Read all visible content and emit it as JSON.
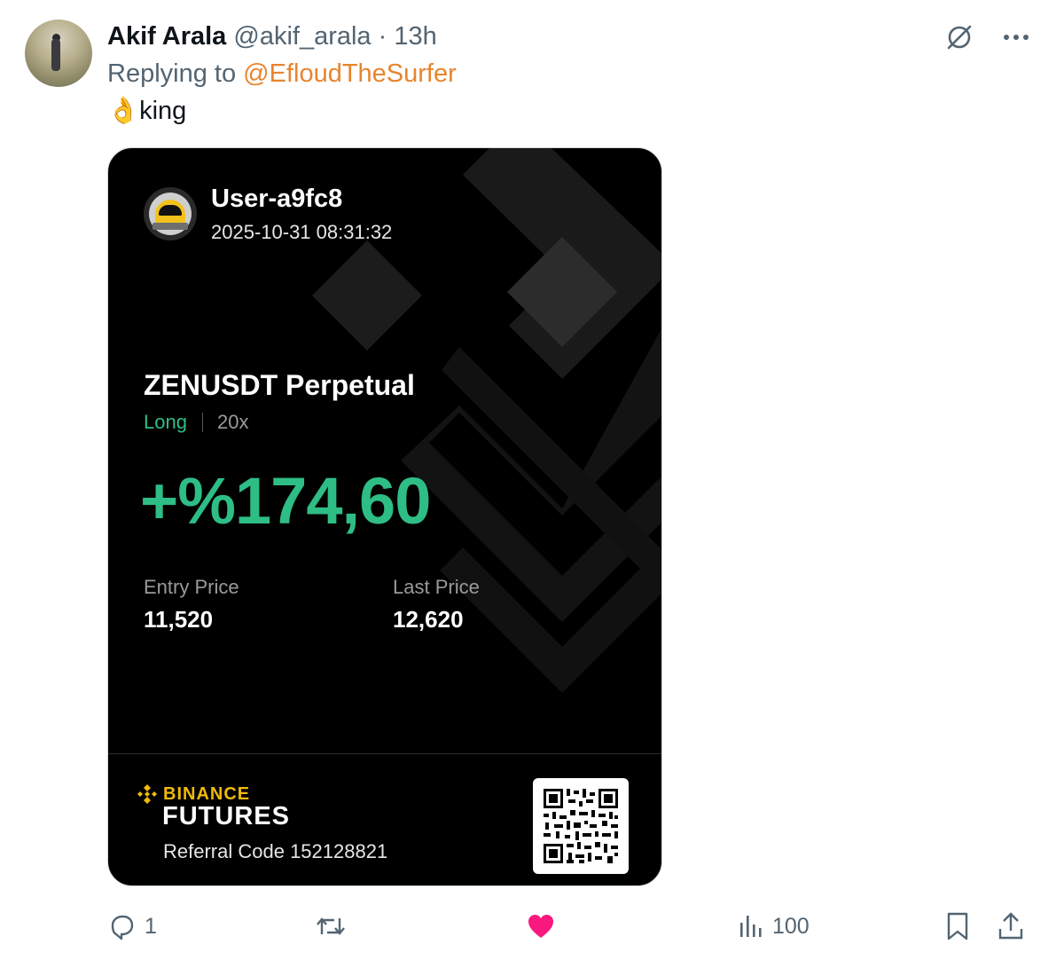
{
  "tweet": {
    "author_name": "Akif Arala",
    "handle": "@akif_arala",
    "separator": "·",
    "time": "13h",
    "reply_prefix": "Replying to",
    "reply_to": "@EfloudTheSurfer",
    "emoji": "👌",
    "text": "king"
  },
  "icons": {
    "grok": "grok-icon",
    "more": "more-icon",
    "reply": "reply-icon",
    "retweet": "retweet-icon",
    "like": "like-icon",
    "views": "views-icon",
    "bookmark": "bookmark-icon",
    "share": "share-icon"
  },
  "card": {
    "username": "User-a9fc8",
    "datetime": "2025-10-31 08:31:32",
    "pair": "ZENUSDT Perpetual",
    "side": "Long",
    "leverage": "20x",
    "pnl": "+%174,60",
    "entry_label": "Entry Price",
    "entry_value": "11,520",
    "last_label": "Last Price",
    "last_value": "12,620",
    "brand_top": "BINANCE",
    "brand_bottom": "FUTURES",
    "referral": "Referral Code 152128821"
  },
  "stats": {
    "replies": "1",
    "views": "100"
  },
  "colors": {
    "like": "#f91880",
    "profit": "#2ebd85",
    "binance": "#f0b90b",
    "mention": "#e8842e"
  }
}
